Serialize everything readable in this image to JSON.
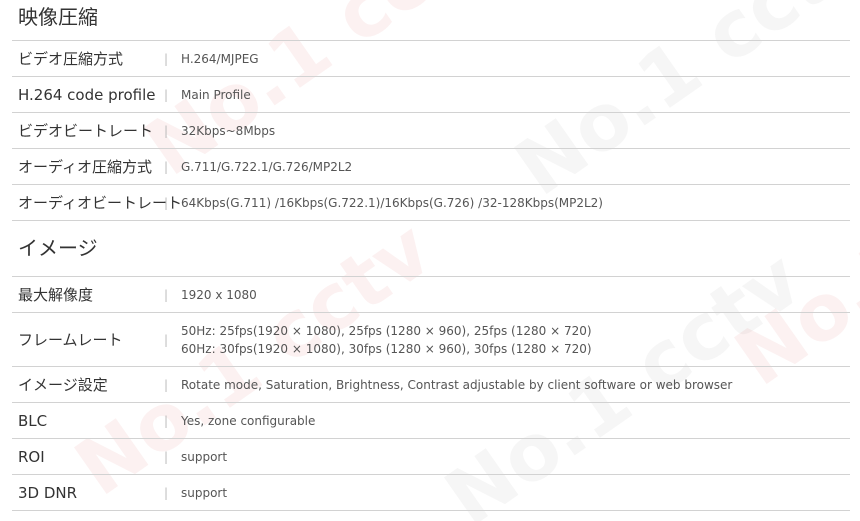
{
  "sections": [
    {
      "title": "映像圧縮",
      "rows": [
        {
          "label": "ビデオ圧縮方式",
          "value": "H.264/MJPEG"
        },
        {
          "label": "H.264 code profile",
          "value": "Main Profile"
        },
        {
          "label": "ビデオビートレート",
          "value": "32Kbps~8Mbps"
        },
        {
          "label": "オーディオ圧縮方式",
          "value": "G.711/G.722.1/G.726/MP2L2"
        },
        {
          "label": "オーディオビートレート",
          "value": "64Kbps(G.711) /16Kbps(G.722.1)/16Kbps(G.726) /32-128Kbps(MP2L2)"
        }
      ]
    },
    {
      "title": "イメージ",
      "rows": [
        {
          "label": "最大解像度",
          "value": "1920 x 1080"
        },
        {
          "label": "フレームレート",
          "value": "50Hz: 25fps(1920 × 1080), 25fps (1280 × 960), 25fps (1280 × 720)",
          "value2": "60Hz: 30fps(1920 × 1080), 30fps (1280 × 960), 30fps (1280 × 720)"
        },
        {
          "label": "イメージ設定",
          "value": "Rotate mode, Saturation, Brightness, Contrast adjustable by client software or web browser"
        },
        {
          "label": "BLC",
          "value": "Yes, zone configurable"
        },
        {
          "label": "ROI",
          "value": "support"
        },
        {
          "label": "3D DNR",
          "value": "support"
        }
      ]
    }
  ],
  "separator": "|",
  "watermark": "No.1 cctv"
}
